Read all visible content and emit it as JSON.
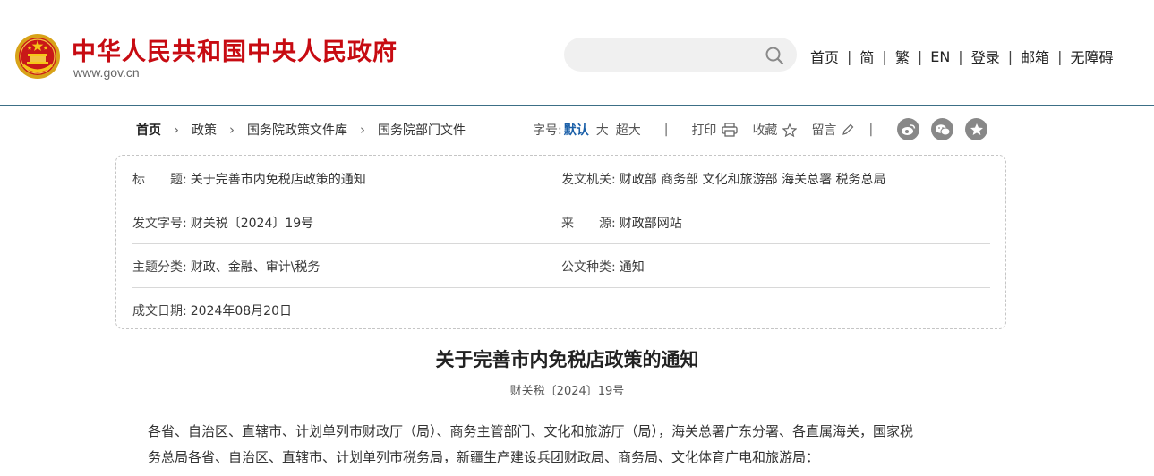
{
  "header": {
    "site_title": "中华人民共和国中央人民政府",
    "site_domain": "www.gov.cn",
    "search_placeholder": "",
    "nav": [
      "首页",
      "简",
      "繁",
      "EN",
      "登录",
      "邮箱",
      "无障碍"
    ],
    "brand_color": "#c70b12"
  },
  "breadcrumb": [
    "首页",
    "政策",
    "国务院政策文件库",
    "国务院部门文件"
  ],
  "tools": {
    "font_size_label": "字号:",
    "font_sizes": [
      "默认",
      "大",
      "超大"
    ],
    "print": "打印",
    "favorite": "收藏",
    "comment": "留言",
    "share_icons": [
      "weibo-icon",
      "wechat-icon",
      "qzone-icon"
    ]
  },
  "info": {
    "title_label": "标　　题:",
    "title": "关于完善市内免税店政策的通知",
    "issuer_label": "发文机关:",
    "issuer": "财政部 商务部 文化和旅游部 海关总署 税务总局",
    "docno_label": "发文字号:",
    "docno": "财关税〔2024〕19号",
    "source_label": "来　　源:",
    "source": "财政部网站",
    "topic_label": "主题分类:",
    "topic": "财政、金融、审计\\税务",
    "doctype_label": "公文种类:",
    "doctype": "通知",
    "date_label": "成文日期:",
    "date": "2024年08月20日"
  },
  "article": {
    "title": "关于完善市内免税店政策的通知",
    "docno": "财关税〔2024〕19号",
    "body_line1": "各省、自治区、直辖市、计划单列市财政厅（局）、商务主管部门、文化和旅游厅（局），海关总署广东分署、各直属海关，国家税",
    "body_line2": "务总局各省、自治区、直辖市、计划单列市税务局，新疆生产建设兵团财政局、商务局、文化体育广电和旅游局："
  }
}
